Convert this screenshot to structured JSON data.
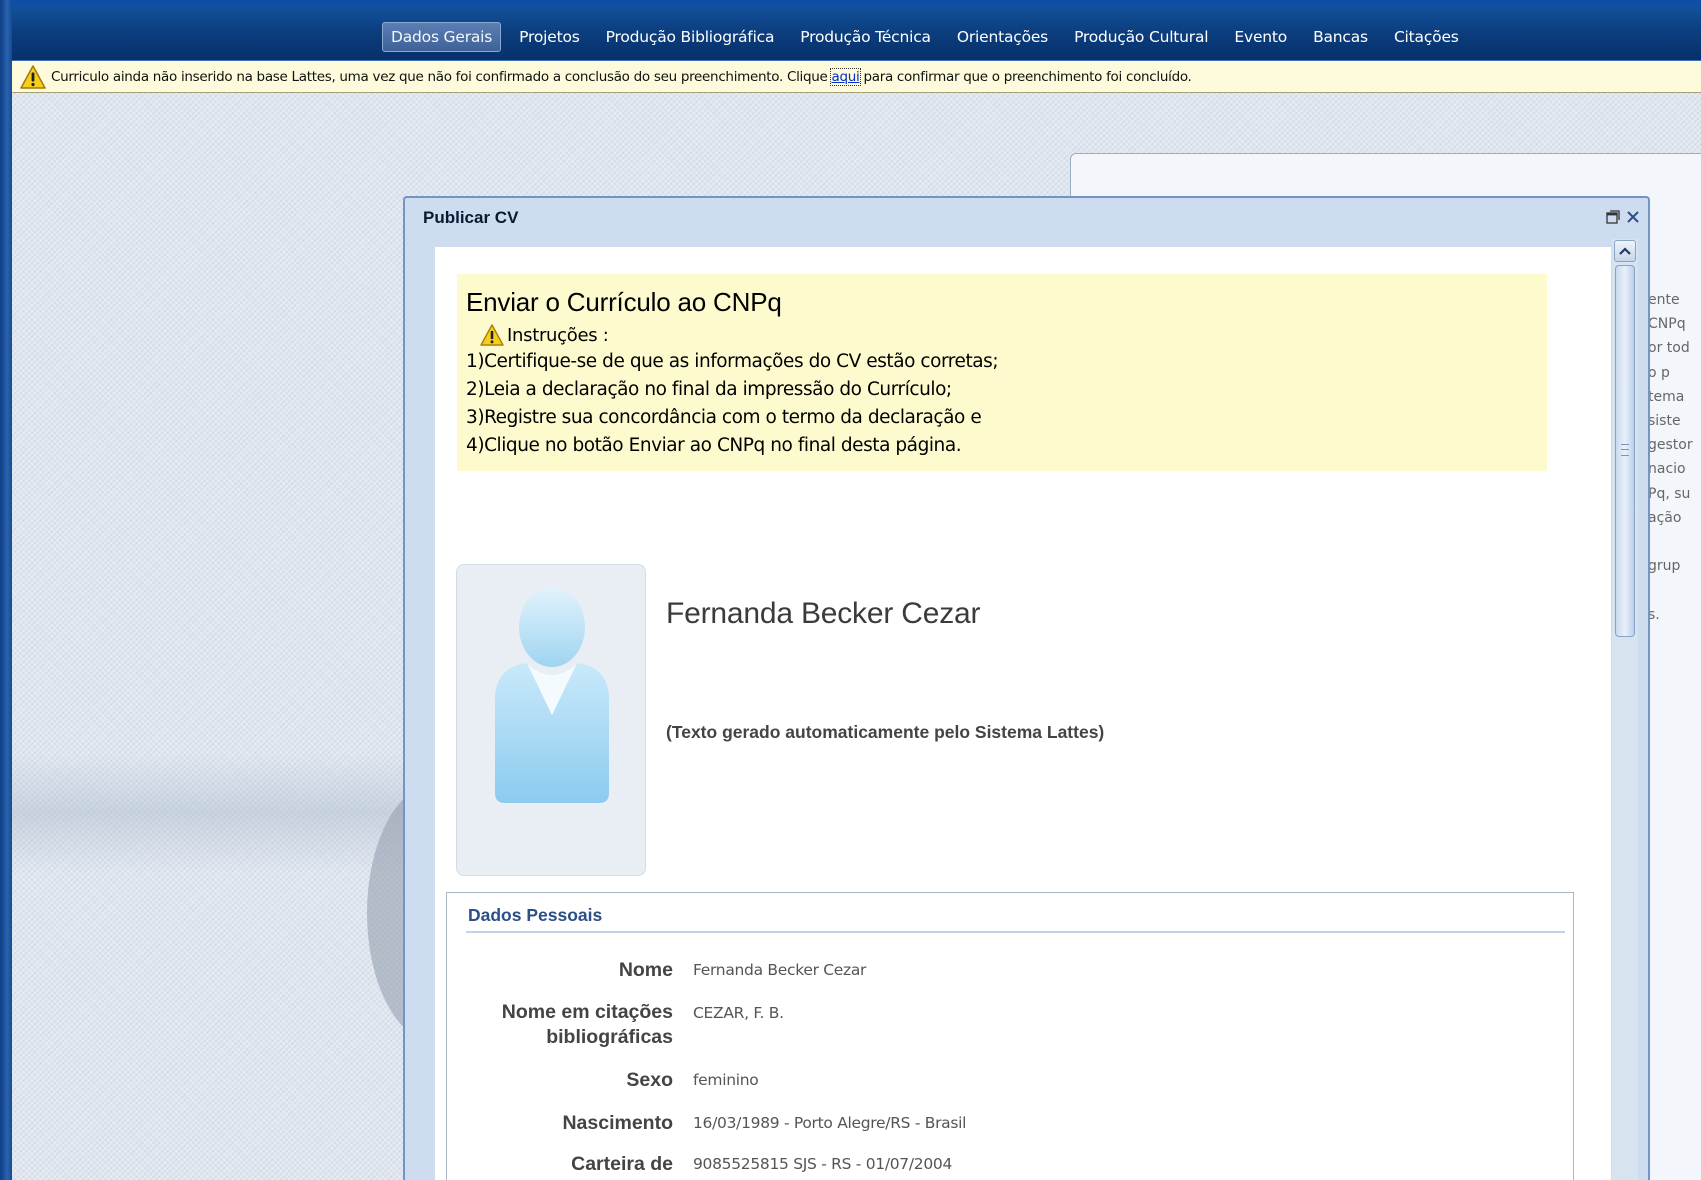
{
  "nav": {
    "items": [
      "Dados Gerais",
      "Projetos",
      "Produção Bibliográfica",
      "Produção Técnica",
      "Orientações",
      "Produção Cultural",
      "Evento",
      "Bancas",
      "Citações"
    ],
    "active": "Dados Gerais"
  },
  "warning": {
    "text_before": "Curriculo ainda não inserido na base Lattes, uma vez que não foi confirmado a conclusão do seu preenchimento. Clique",
    "link": "aqui",
    "text_after": "para confirmar que o preenchimento foi concluído."
  },
  "background_panel": {
    "fragments": [
      "ente",
      "CNPq",
      "or tod",
      "o  p",
      "tema",
      " siste",
      "gestor",
      " nacio",
      "Pq, su",
      "ação",
      "",
      " grup",
      "",
      "s."
    ]
  },
  "dialog": {
    "title": "Publicar CV",
    "instructions": {
      "title": "Enviar o Currículo ao CNPq",
      "heading": "Instruções :",
      "lines": [
        "1)Certifique-se de que as informações do CV estão corretas;",
        "2)Leia a declaração no final da impressão do Currículo;",
        "3)Registre sua concordância com o termo da declaração e",
        "4)Clique no botão Enviar ao CNPq no final desta página."
      ]
    },
    "profile": {
      "name": "Fernanda Becker Cezar",
      "note": "(Texto gerado automaticamente pelo Sistema Lattes)"
    },
    "dados_pessoais": {
      "title": "Dados Pessoais",
      "fields": [
        {
          "label": "Nome",
          "value": "Fernanda Becker Cezar"
        },
        {
          "label": "Nome em citações bibliográficas",
          "value": "CEZAR, F. B."
        },
        {
          "label": "Sexo",
          "value": "feminino"
        },
        {
          "label": "Nascimento",
          "value": "16/03/1989 - Porto Alegre/RS - Brasil"
        },
        {
          "label": "Carteira de",
          "value": "9085525815 SJS - RS - 01/07/2004"
        }
      ]
    }
  },
  "colors": {
    "nav_bg": "#0c3f80",
    "warning_bg": "#fdfbdc",
    "instructions_bg": "#fdfbce",
    "section_title": "#2c4f86"
  }
}
